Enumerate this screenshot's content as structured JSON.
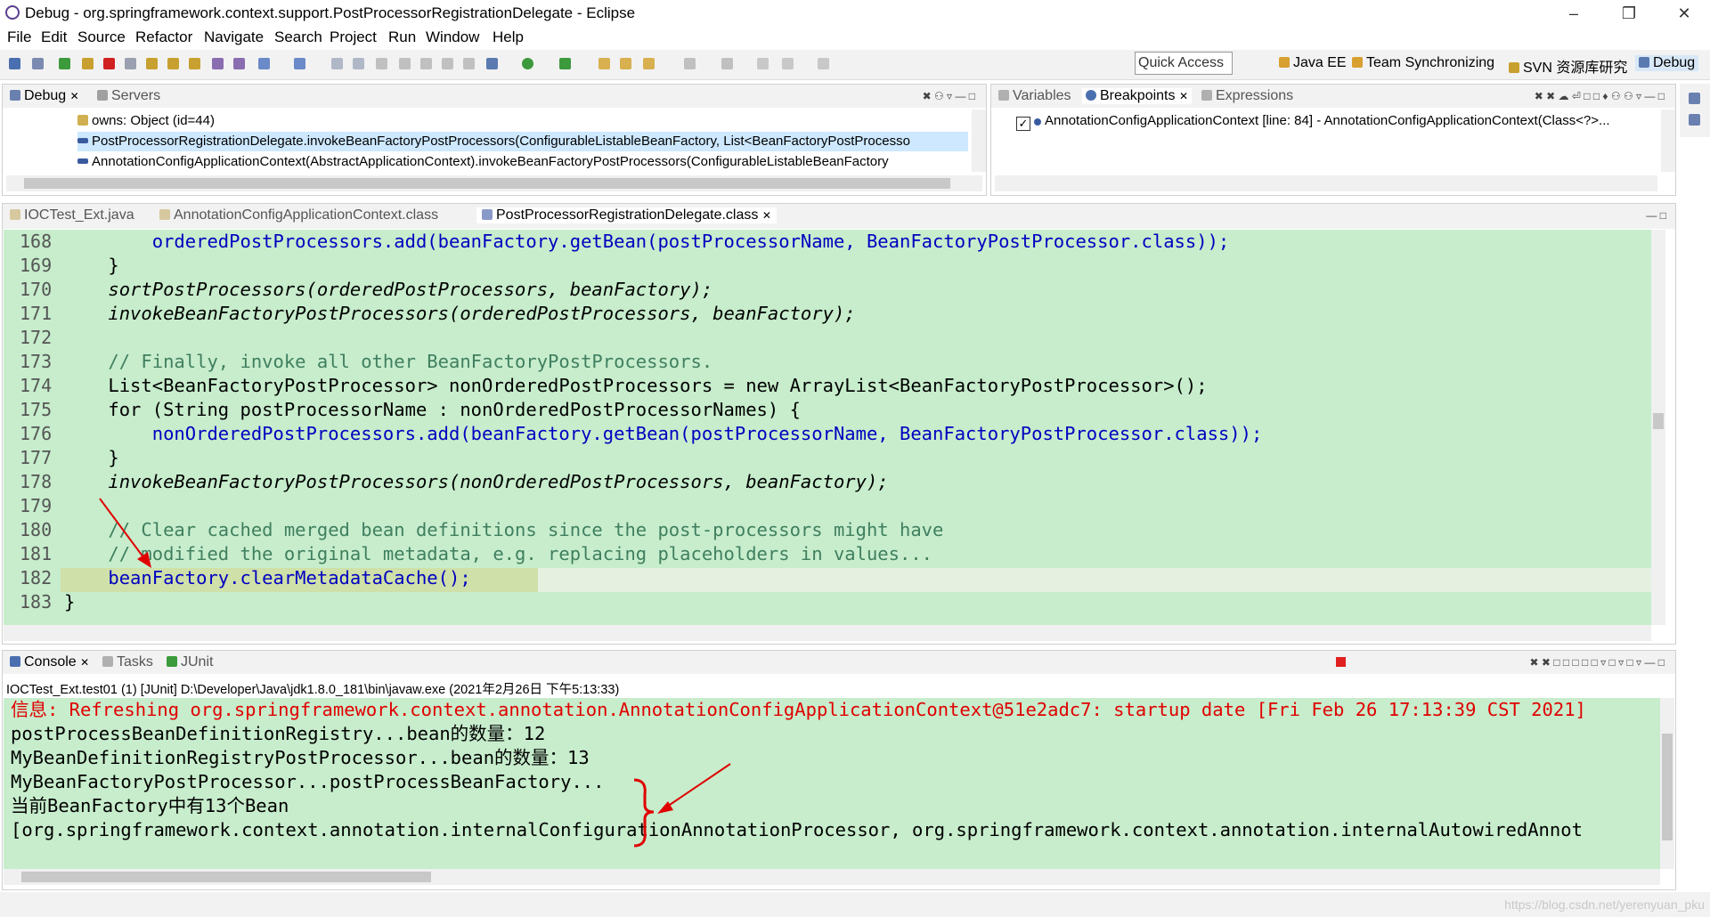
{
  "window": {
    "title": "Debug - org.springframework.context.support.PostProcessorRegistrationDelegate - Eclipse"
  },
  "menu": [
    "File",
    "Edit",
    "Source",
    "Refactor",
    "Navigate",
    "Search",
    "Project",
    "Run",
    "Window",
    "Help"
  ],
  "quick_access": "Quick Access",
  "perspectives": [
    "Java EE",
    "Team Synchronizing",
    "SVN 资源库研究",
    "Debug"
  ],
  "debug_view": {
    "tabs": [
      "Debug",
      "Servers"
    ],
    "rows": [
      "owns: Object  (id=44)",
      "PostProcessorRegistrationDelegate.invokeBeanFactoryPostProcessors(ConfigurableListableBeanFactory, List<BeanFactoryPostProcesso",
      "AnnotationConfigApplicationContext(AbstractApplicationContext).invokeBeanFactoryPostProcessors(ConfigurableListableBeanFactory"
    ]
  },
  "breakpoints_view": {
    "tabs": [
      "Variables",
      "Breakpoints",
      "Expressions"
    ],
    "rows": [
      "AnnotationConfigApplicationContext [line: 84] - AnnotationConfigApplicationContext(Class<?>..."
    ]
  },
  "editor": {
    "tabs": [
      "IOCTest_Ext.java",
      "AnnotationConfigApplicationContext.class",
      "PostProcessorRegistrationDelegate.class"
    ],
    "line_numbers": [
      "168",
      "169",
      "170",
      "171",
      "172",
      "173",
      "174",
      "175",
      "176",
      "177",
      "178",
      "179",
      "180",
      "181",
      "182",
      "183"
    ],
    "lines": [
      "        orderedPostProcessors.add(beanFactory.getBean(postProcessorName, BeanFactoryPostProcessor.class));",
      "    }",
      "    sortPostProcessors(orderedPostProcessors, beanFactory);",
      "    invokeBeanFactoryPostProcessors(orderedPostProcessors, beanFactory);",
      "",
      "    // Finally, invoke all other BeanFactoryPostProcessors.",
      "    List<BeanFactoryPostProcessor> nonOrderedPostProcessors = new ArrayList<BeanFactoryPostProcessor>();",
      "    for (String postProcessorName : nonOrderedPostProcessorNames) {",
      "        nonOrderedPostProcessors.add(beanFactory.getBean(postProcessorName, BeanFactoryPostProcessor.class));",
      "    }",
      "    invokeBeanFactoryPostProcessors(nonOrderedPostProcessors, beanFactory);",
      "",
      "    // Clear cached merged bean definitions since the post-processors might have",
      "    // modified the original metadata, e.g. replacing placeholders in values...",
      "    beanFactory.clearMetadataCache();",
      "}"
    ]
  },
  "console": {
    "tabs": [
      "Console",
      "Tasks",
      "JUnit"
    ],
    "process": "IOCTest_Ext.test01 (1) [JUnit] D:\\Developer\\Java\\jdk1.8.0_181\\bin\\javaw.exe (2021年2月26日 下午5:13:33)",
    "lines": [
      "信息: Refreshing org.springframework.context.annotation.AnnotationConfigApplicationContext@51e2adc7: startup date [Fri Feb 26 17:13:39 CST 2021]",
      "postProcessBeanDefinitionRegistry...bean的数量：12",
      "MyBeanDefinitionRegistryPostProcessor...bean的数量：13",
      "MyBeanFactoryPostProcessor...postProcessBeanFactory...",
      "当前BeanFactory中有13个Bean",
      "[org.springframework.context.annotation.internalConfigurationAnnotationProcessor, org.springframework.context.annotation.internalAutowiredAnnot"
    ]
  },
  "watermark": "https://blog.csdn.net/yerenyuan_pku",
  "colors": {
    "editor_bg": "#c7edcc",
    "selection": "#cde8ff",
    "error_text": "#e00000",
    "annotation_arrow": "#e00000"
  }
}
